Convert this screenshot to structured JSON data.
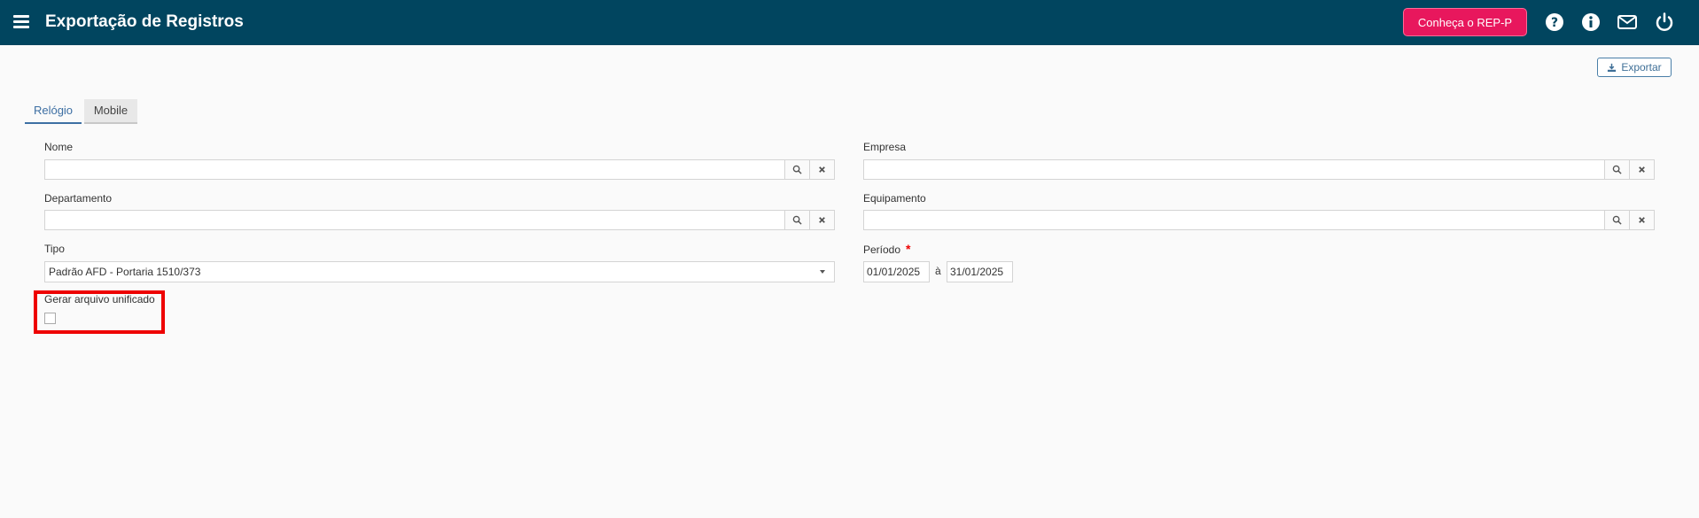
{
  "header": {
    "title": "Exportação de Registros",
    "rep_button_label": "Conheça o REP-P",
    "icons": [
      "menu-icon",
      "help-icon",
      "info-icon",
      "mail-icon",
      "power-icon"
    ],
    "background_color": "#01455f",
    "accent_color": "#e8175d"
  },
  "toolbar": {
    "export_label": "Exportar"
  },
  "tabs": [
    {
      "label": "Relógio",
      "active": true
    },
    {
      "label": "Mobile",
      "active": false
    }
  ],
  "form": {
    "nome": {
      "label": "Nome",
      "value": ""
    },
    "empresa": {
      "label": "Empresa",
      "value": ""
    },
    "departamento": {
      "label": "Departamento",
      "value": ""
    },
    "equipamento": {
      "label": "Equipamento",
      "value": ""
    },
    "tipo": {
      "label": "Tipo",
      "value": "Padrão AFD - Portaria 1510/373"
    },
    "periodo": {
      "label": "Período",
      "required_mark": "*",
      "start": "01/01/2025",
      "separator": "à",
      "end": "31/01/2025"
    },
    "unificado": {
      "label": "Gerar arquivo unificado",
      "checked": false
    }
  }
}
